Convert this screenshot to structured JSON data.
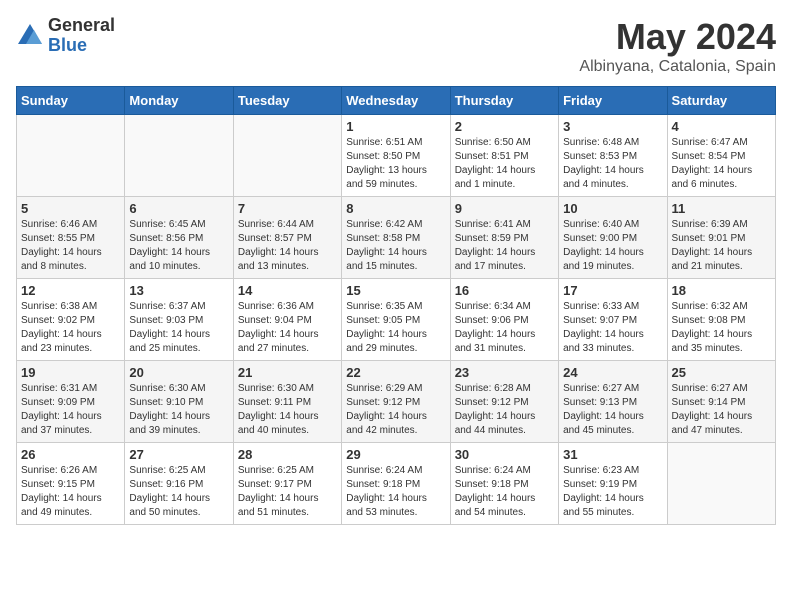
{
  "logo": {
    "general": "General",
    "blue": "Blue"
  },
  "title": "May 2024",
  "subtitle": "Albinyana, Catalonia, Spain",
  "days_of_week": [
    "Sunday",
    "Monday",
    "Tuesday",
    "Wednesday",
    "Thursday",
    "Friday",
    "Saturday"
  ],
  "weeks": [
    [
      {
        "day": "",
        "info": ""
      },
      {
        "day": "",
        "info": ""
      },
      {
        "day": "",
        "info": ""
      },
      {
        "day": "1",
        "info": "Sunrise: 6:51 AM\nSunset: 8:50 PM\nDaylight: 13 hours\nand 59 minutes."
      },
      {
        "day": "2",
        "info": "Sunrise: 6:50 AM\nSunset: 8:51 PM\nDaylight: 14 hours\nand 1 minute."
      },
      {
        "day": "3",
        "info": "Sunrise: 6:48 AM\nSunset: 8:53 PM\nDaylight: 14 hours\nand 4 minutes."
      },
      {
        "day": "4",
        "info": "Sunrise: 6:47 AM\nSunset: 8:54 PM\nDaylight: 14 hours\nand 6 minutes."
      }
    ],
    [
      {
        "day": "5",
        "info": "Sunrise: 6:46 AM\nSunset: 8:55 PM\nDaylight: 14 hours\nand 8 minutes."
      },
      {
        "day": "6",
        "info": "Sunrise: 6:45 AM\nSunset: 8:56 PM\nDaylight: 14 hours\nand 10 minutes."
      },
      {
        "day": "7",
        "info": "Sunrise: 6:44 AM\nSunset: 8:57 PM\nDaylight: 14 hours\nand 13 minutes."
      },
      {
        "day": "8",
        "info": "Sunrise: 6:42 AM\nSunset: 8:58 PM\nDaylight: 14 hours\nand 15 minutes."
      },
      {
        "day": "9",
        "info": "Sunrise: 6:41 AM\nSunset: 8:59 PM\nDaylight: 14 hours\nand 17 minutes."
      },
      {
        "day": "10",
        "info": "Sunrise: 6:40 AM\nSunset: 9:00 PM\nDaylight: 14 hours\nand 19 minutes."
      },
      {
        "day": "11",
        "info": "Sunrise: 6:39 AM\nSunset: 9:01 PM\nDaylight: 14 hours\nand 21 minutes."
      }
    ],
    [
      {
        "day": "12",
        "info": "Sunrise: 6:38 AM\nSunset: 9:02 PM\nDaylight: 14 hours\nand 23 minutes."
      },
      {
        "day": "13",
        "info": "Sunrise: 6:37 AM\nSunset: 9:03 PM\nDaylight: 14 hours\nand 25 minutes."
      },
      {
        "day": "14",
        "info": "Sunrise: 6:36 AM\nSunset: 9:04 PM\nDaylight: 14 hours\nand 27 minutes."
      },
      {
        "day": "15",
        "info": "Sunrise: 6:35 AM\nSunset: 9:05 PM\nDaylight: 14 hours\nand 29 minutes."
      },
      {
        "day": "16",
        "info": "Sunrise: 6:34 AM\nSunset: 9:06 PM\nDaylight: 14 hours\nand 31 minutes."
      },
      {
        "day": "17",
        "info": "Sunrise: 6:33 AM\nSunset: 9:07 PM\nDaylight: 14 hours\nand 33 minutes."
      },
      {
        "day": "18",
        "info": "Sunrise: 6:32 AM\nSunset: 9:08 PM\nDaylight: 14 hours\nand 35 minutes."
      }
    ],
    [
      {
        "day": "19",
        "info": "Sunrise: 6:31 AM\nSunset: 9:09 PM\nDaylight: 14 hours\nand 37 minutes."
      },
      {
        "day": "20",
        "info": "Sunrise: 6:30 AM\nSunset: 9:10 PM\nDaylight: 14 hours\nand 39 minutes."
      },
      {
        "day": "21",
        "info": "Sunrise: 6:30 AM\nSunset: 9:11 PM\nDaylight: 14 hours\nand 40 minutes."
      },
      {
        "day": "22",
        "info": "Sunrise: 6:29 AM\nSunset: 9:12 PM\nDaylight: 14 hours\nand 42 minutes."
      },
      {
        "day": "23",
        "info": "Sunrise: 6:28 AM\nSunset: 9:12 PM\nDaylight: 14 hours\nand 44 minutes."
      },
      {
        "day": "24",
        "info": "Sunrise: 6:27 AM\nSunset: 9:13 PM\nDaylight: 14 hours\nand 45 minutes."
      },
      {
        "day": "25",
        "info": "Sunrise: 6:27 AM\nSunset: 9:14 PM\nDaylight: 14 hours\nand 47 minutes."
      }
    ],
    [
      {
        "day": "26",
        "info": "Sunrise: 6:26 AM\nSunset: 9:15 PM\nDaylight: 14 hours\nand 49 minutes."
      },
      {
        "day": "27",
        "info": "Sunrise: 6:25 AM\nSunset: 9:16 PM\nDaylight: 14 hours\nand 50 minutes."
      },
      {
        "day": "28",
        "info": "Sunrise: 6:25 AM\nSunset: 9:17 PM\nDaylight: 14 hours\nand 51 minutes."
      },
      {
        "day": "29",
        "info": "Sunrise: 6:24 AM\nSunset: 9:18 PM\nDaylight: 14 hours\nand 53 minutes."
      },
      {
        "day": "30",
        "info": "Sunrise: 6:24 AM\nSunset: 9:18 PM\nDaylight: 14 hours\nand 54 minutes."
      },
      {
        "day": "31",
        "info": "Sunrise: 6:23 AM\nSunset: 9:19 PM\nDaylight: 14 hours\nand 55 minutes."
      },
      {
        "day": "",
        "info": ""
      }
    ]
  ]
}
